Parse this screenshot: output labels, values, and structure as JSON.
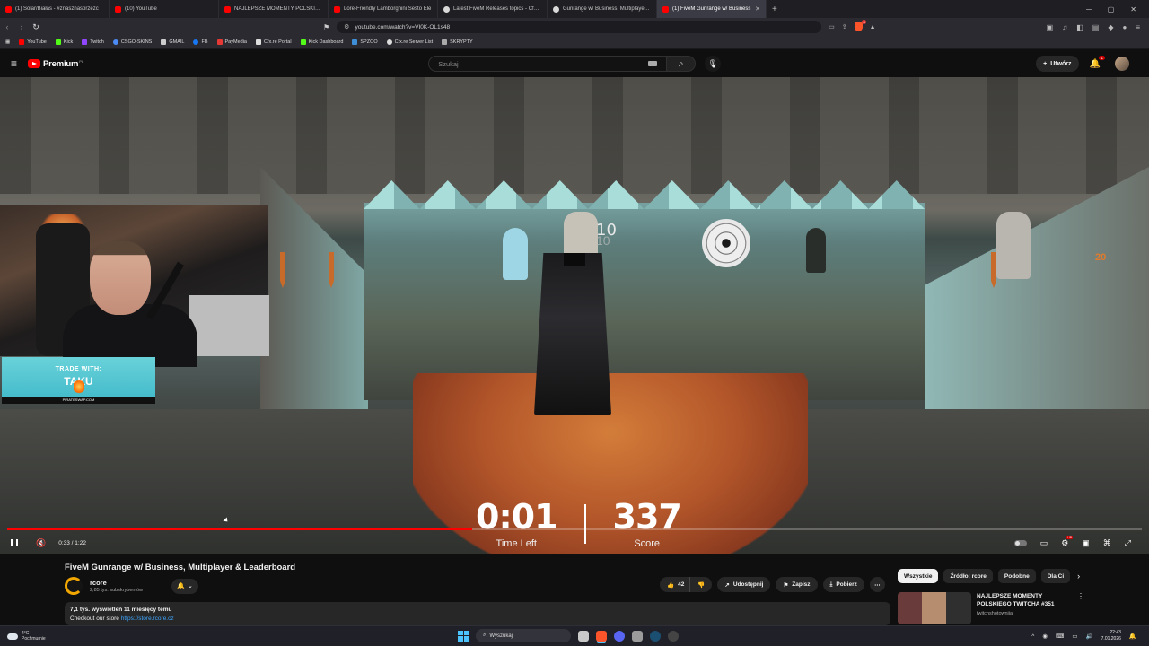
{
  "browser": {
    "tabs": [
      {
        "label": "(1) Solar/Białas - #znasznasprzezc"
      },
      {
        "label": "(10) YouTube"
      },
      {
        "label": "NAJLEPSZE MOMENTY POLSKIEGO T"
      },
      {
        "label": "Lore-Friendly Lamborghini Sesto Ele"
      },
      {
        "label": "Latest FiveM Releases topics - Cfx.re"
      },
      {
        "label": "Gunrange w/ Business, Multiplayer &"
      },
      {
        "label": "(1) FiveM Gunrange w/ Business"
      }
    ],
    "active_tab": 6,
    "url": "youtube.com/watch?v=VI0K-OL1s48",
    "extension_badge": "4",
    "bookmarks": [
      {
        "label": "YouTube",
        "color": "#ff0000"
      },
      {
        "label": "Kick",
        "color": "#53fc18"
      },
      {
        "label": "Twitch",
        "color": "#9146ff"
      },
      {
        "label": "CSGO-SKINS",
        "color": "#4c8bf5"
      },
      {
        "label": "GMAIL",
        "color": "#cccccc"
      },
      {
        "label": "FB",
        "color": "#1877f2"
      },
      {
        "label": "PayMedia",
        "color": "#e53935"
      },
      {
        "label": "Cfx.re Portal",
        "color": "#dddddd"
      },
      {
        "label": "Kick Dashboard",
        "color": "#53fc18"
      },
      {
        "label": "SPZOO",
        "color": "#3f8fd8"
      },
      {
        "label": "Cfx.re Server List",
        "color": "#dddddd"
      },
      {
        "label": "SKRYPTY",
        "color": "#aaaaaa"
      }
    ]
  },
  "youtube": {
    "logo_text": "Premium",
    "logo_region": "PL",
    "search_placeholder": "Szukaj",
    "create_label": "Utwórz",
    "notifications_count": "1"
  },
  "video": {
    "hud_time": "0:01",
    "hud_time_label": "Time Left",
    "hud_score": "337",
    "hud_score_label": "Score",
    "hit_number": "10",
    "lane_number": "20",
    "promo_line1": "TRADE WITH:",
    "promo_line2": "TAKU",
    "promo_line3": "PIRATESWAP.COM",
    "timecode": "0:33 / 1:22",
    "progress": 0.41,
    "title": "FiveM Gunrange w/ Business, Multiplayer & Leaderboard"
  },
  "channel": {
    "name": "rcore",
    "subscribers": "2,85 tys. subskrybentów"
  },
  "actions": {
    "likes": "42",
    "share": "Udostępnij",
    "save": "Zapisz",
    "download": "Pobierz"
  },
  "description": {
    "stats": "7,1 tys. wyświetleń  11 miesięcy temu",
    "text": "Checkout our store ",
    "link": "https://store.rcore.cz"
  },
  "chips": [
    "Wszystkie",
    "Źródło: rcore",
    "Podobne",
    "Dla Ci"
  ],
  "recommendation": {
    "title": "NAJLEPSZE MOMENTY POLSKIEGO TWITCHA #351",
    "channel": "twitchshotowniia"
  },
  "taskbar": {
    "temp": "4°C",
    "weather": "Pochmurnie",
    "search": "Wyszukaj",
    "time": "22:43",
    "date": "7.01.2026"
  }
}
